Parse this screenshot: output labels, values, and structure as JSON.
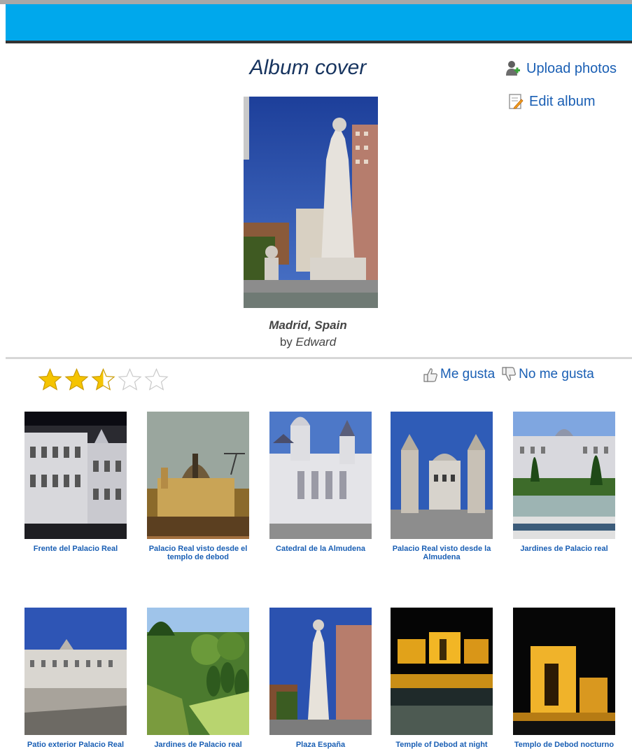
{
  "header": {
    "album_heading": "Album cover"
  },
  "actions": {
    "upload_label": "Upload photos",
    "edit_label": "Edit album"
  },
  "album": {
    "name": "Madrid, Spain",
    "by_label": "by",
    "owner": "Edward"
  },
  "rating": {
    "value": 2.5,
    "max": 5
  },
  "reactions": {
    "like_label": "Me gusta",
    "dislike_label": "No me gusta"
  },
  "photos": [
    {
      "caption": "Frente del Palacio Real"
    },
    {
      "caption": "Palacio Real visto desde el templo de debod"
    },
    {
      "caption": "Catedral de la Almudena"
    },
    {
      "caption": "Palacio Real visto desde la Almudena"
    },
    {
      "caption": "Jardines de Palacio real"
    },
    {
      "caption": "Patio exterior Palacio Real"
    },
    {
      "caption": "Jardines de Palacio real"
    },
    {
      "caption": "Plaza España"
    },
    {
      "caption": "Temple of Debod at night"
    },
    {
      "caption": "Templo de Debod nocturno"
    }
  ],
  "colors": {
    "topbar": "#00a8ec",
    "link": "#1a5fb4",
    "heading": "#17345f",
    "star_filled": "#f5c400"
  },
  "icons": {
    "upload": "user-add-icon",
    "edit": "edit-document-icon",
    "like": "thumbs-up-icon",
    "dislike": "thumbs-down-icon",
    "star": "star-icon"
  }
}
